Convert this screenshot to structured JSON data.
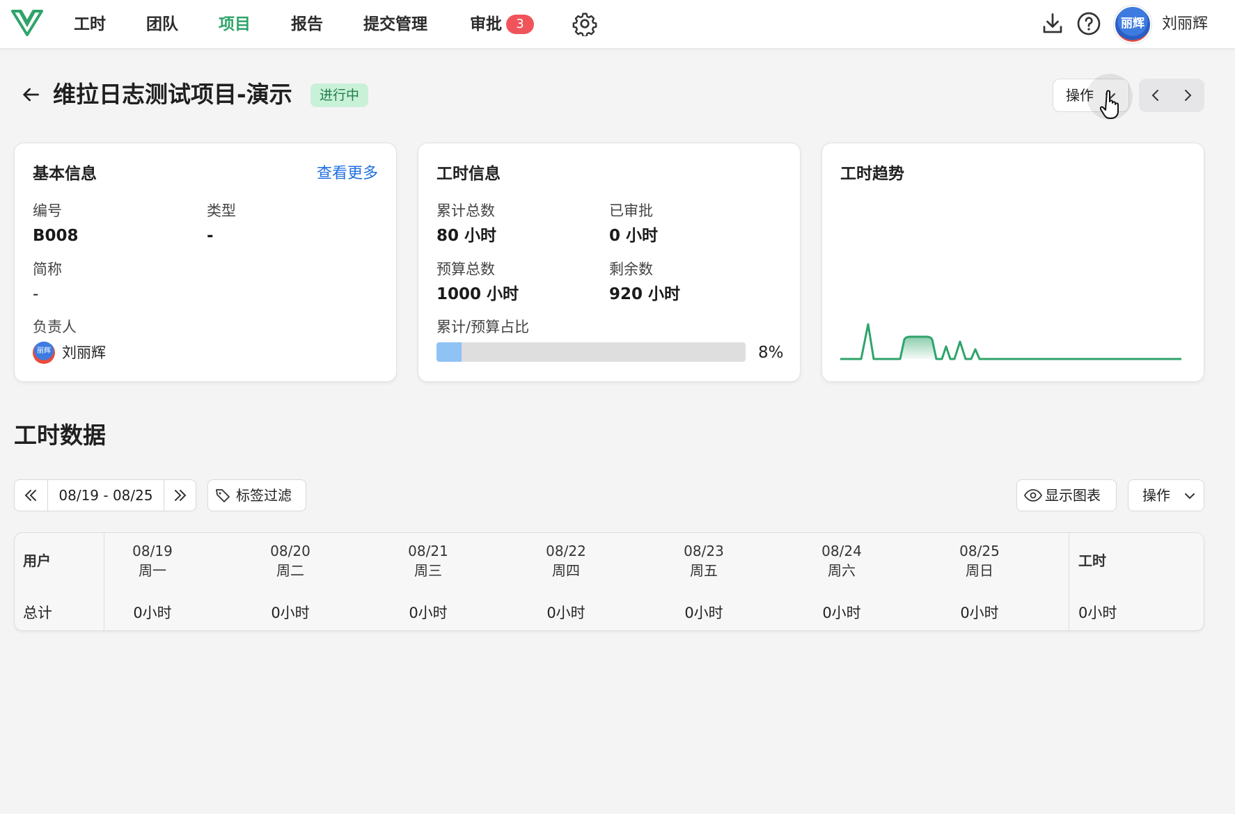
{
  "nav": {
    "items": [
      {
        "label": "工时",
        "active": false
      },
      {
        "label": "团队",
        "active": false
      },
      {
        "label": "项目",
        "active": true
      },
      {
        "label": "报告",
        "active": false
      },
      {
        "label": "提交管理",
        "active": false
      },
      {
        "label": "审批",
        "active": false
      }
    ],
    "approval_badge": "3",
    "settings_icon": "gear-icon",
    "download_icon": "download-icon",
    "help_icon": "help-icon",
    "avatar_text": "丽辉",
    "user_name": "刘丽辉"
  },
  "header": {
    "title": "维拉日志测试项目-演示",
    "status": "进行中",
    "action_label": "操作"
  },
  "basic_info": {
    "title": "基本信息",
    "more_link": "查看更多",
    "code_label": "编号",
    "code_value": "B008",
    "type_label": "类型",
    "type_value": "-",
    "short_label": "简称",
    "short_value": "-",
    "owner_label": "负责人",
    "owner_avatar_text": "丽辉",
    "owner_name": "刘丽辉"
  },
  "hours_info": {
    "title": "工时信息",
    "total_label": "累计总数",
    "total_value": "80 小时",
    "approved_label": "已审批",
    "approved_value": "0 小时",
    "budget_label": "预算总数",
    "budget_value": "1000 小时",
    "remaining_label": "剩余数",
    "remaining_value": "920 小时",
    "ratio_label": "累计/预算占比",
    "ratio_percent": 8,
    "ratio_text": "8%"
  },
  "trend": {
    "title": "工时趋势",
    "color": "#2fa36b"
  },
  "data_section": {
    "title": "工时数据",
    "date_range": "08/19 - 08/25",
    "tag_filter": "标签过滤",
    "show_chart": "显示图表",
    "action_label": "操作",
    "user_header": "用户",
    "hours_header": "工时",
    "days": [
      {
        "date": "08/19",
        "weekday": "周一",
        "total": "0小时"
      },
      {
        "date": "08/20",
        "weekday": "周二",
        "total": "0小时"
      },
      {
        "date": "08/21",
        "weekday": "周三",
        "total": "0小时"
      },
      {
        "date": "08/22",
        "weekday": "周四",
        "total": "0小时"
      },
      {
        "date": "08/23",
        "weekday": "周五",
        "total": "0小时"
      },
      {
        "date": "08/24",
        "weekday": "周六",
        "total": "0小时"
      },
      {
        "date": "08/25",
        "weekday": "周日",
        "total": "0小时"
      }
    ],
    "total_row_label": "总计",
    "total_hours": "0小时"
  },
  "colors": {
    "accent": "#2fa36b",
    "link": "#1f6fe0",
    "badge": "#f0545a",
    "progress": "#8fc2f5"
  }
}
